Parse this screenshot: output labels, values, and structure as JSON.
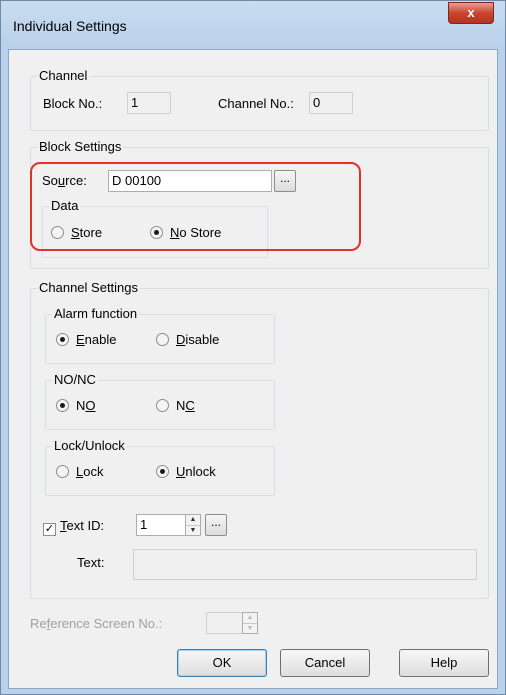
{
  "window": {
    "title": "Individual Settings",
    "close_glyph": "x"
  },
  "channel": {
    "title": "Channel",
    "block_no_label": "Block No.:",
    "block_no_value": "1",
    "channel_no_label": "Channel No.:",
    "channel_no_value": "0"
  },
  "block_settings": {
    "title": "Block Settings",
    "source_label_pre": "So",
    "source_label_u": "u",
    "source_label_post": "rce:",
    "source_value": "D 00100",
    "browse_label": "...",
    "data": {
      "title": "Data",
      "store_u": "S",
      "store_rest": "tore",
      "store_checked": false,
      "nostore_u": "N",
      "nostore_rest": "o Store",
      "nostore_checked": true
    },
    "highlight_color": "#e0312b"
  },
  "channel_settings": {
    "title": "Channel Settings",
    "alarm": {
      "title": "Alarm function",
      "enable_u": "E",
      "enable_rest": "nable",
      "enable_checked": true,
      "disable_u": "D",
      "disable_rest": "isable",
      "disable_checked": false
    },
    "nonc": {
      "title": "NO/NC",
      "no_pre": "N",
      "no_u": "O",
      "no_checked": true,
      "nc_pre": "N",
      "nc_u": "C",
      "nc_checked": false
    },
    "lock": {
      "title": "Lock/Unlock",
      "lock_u": "L",
      "lock_rest": "ock",
      "lock_checked": false,
      "unlock_u": "U",
      "unlock_rest": "nlock",
      "unlock_checked": true
    },
    "text_id": {
      "checked": true,
      "check_glyph": "✓",
      "label_u": "T",
      "label_rest": "ext ID:",
      "value": "1",
      "browse_label": "..."
    },
    "text": {
      "label": "Text:",
      "value": ""
    }
  },
  "reference_screen": {
    "label_pre": "Re",
    "label_u": "f",
    "label_post": "erence Screen No.:",
    "value": ""
  },
  "buttons": {
    "ok": "OK",
    "cancel": "Cancel",
    "help": "Help"
  }
}
